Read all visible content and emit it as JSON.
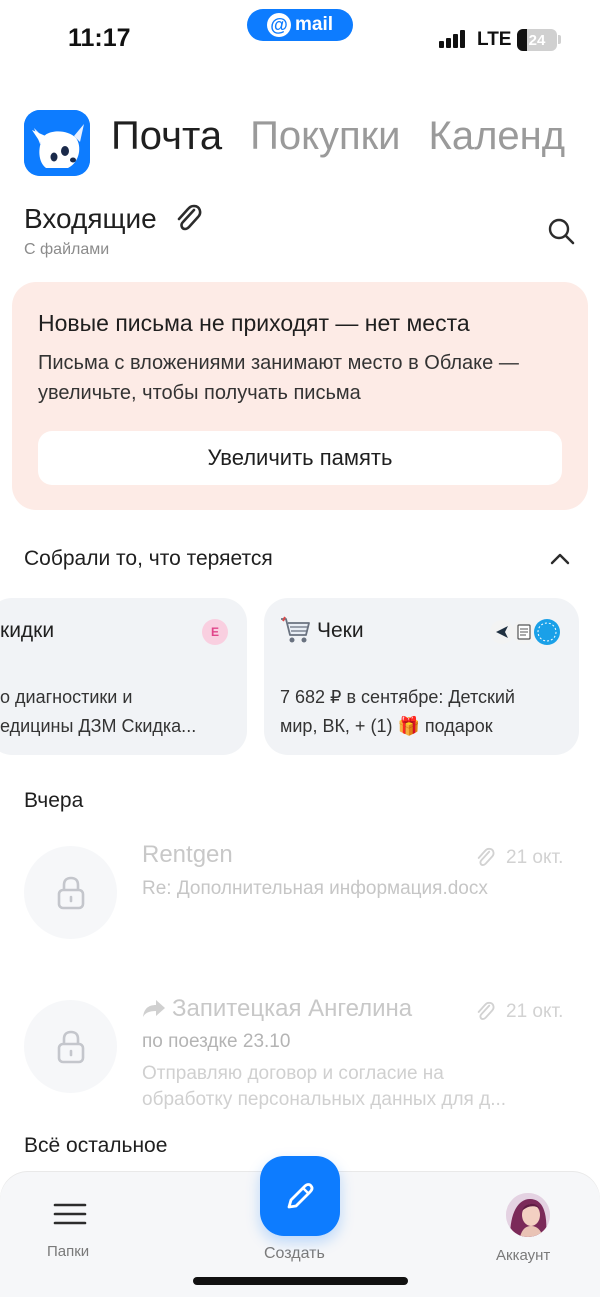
{
  "status_bar": {
    "time": "11:17",
    "mail_pill": "mail",
    "network": "LTE",
    "battery": "24",
    "battery_level": 0.24
  },
  "header": {
    "tabs": [
      "Почта",
      "Покупки",
      "Календ"
    ],
    "active_tab": "Почта"
  },
  "folder": {
    "title": "Входящие",
    "subtitle": "С файлами"
  },
  "alert": {
    "title": "Новые письма не приходят — нет места",
    "text": "Письма с вложениями занимают место в Облаке — увеличьте, чтобы получать письма",
    "button": "Увеличить память"
  },
  "collected": {
    "title": "Собрали то, что теряется",
    "cards": [
      {
        "title": "кидки",
        "badge": "E",
        "text_line1": "о диагностики и",
        "text_line2": "едицины ДЗМ Скидка..."
      },
      {
        "title": "Чеки",
        "icon": "cart-icon",
        "text_line1": "7 682 ₽ в сентябре: Детский",
        "text_line2": "мир, ВК, + (1) 🎁 подарок"
      }
    ]
  },
  "mail_groups": [
    {
      "label": "Вчера",
      "items": [
        {
          "sender": "Rentgen",
          "subject": "Re: Дополнительная информация.docx",
          "date": "21 окт.",
          "has_attachment": true,
          "forwarded": false
        },
        {
          "sender": "Запитецкая Ангелина",
          "subject": "по поездке 23.10",
          "preview_line1": "Отправляю договор и согласие на",
          "preview_line2": "обработку персональных данных для д...",
          "date": "21 окт.",
          "has_attachment": true,
          "forwarded": true
        }
      ]
    },
    {
      "label": "Всё остальное",
      "items": []
    }
  ],
  "bottom_nav": {
    "folders": "Папки",
    "compose": "Создать",
    "account": "Аккаунт"
  },
  "colors": {
    "accent": "#0d7cff",
    "alert_bg": "#fdebe6",
    "card_bg": "#f1f3f6"
  }
}
